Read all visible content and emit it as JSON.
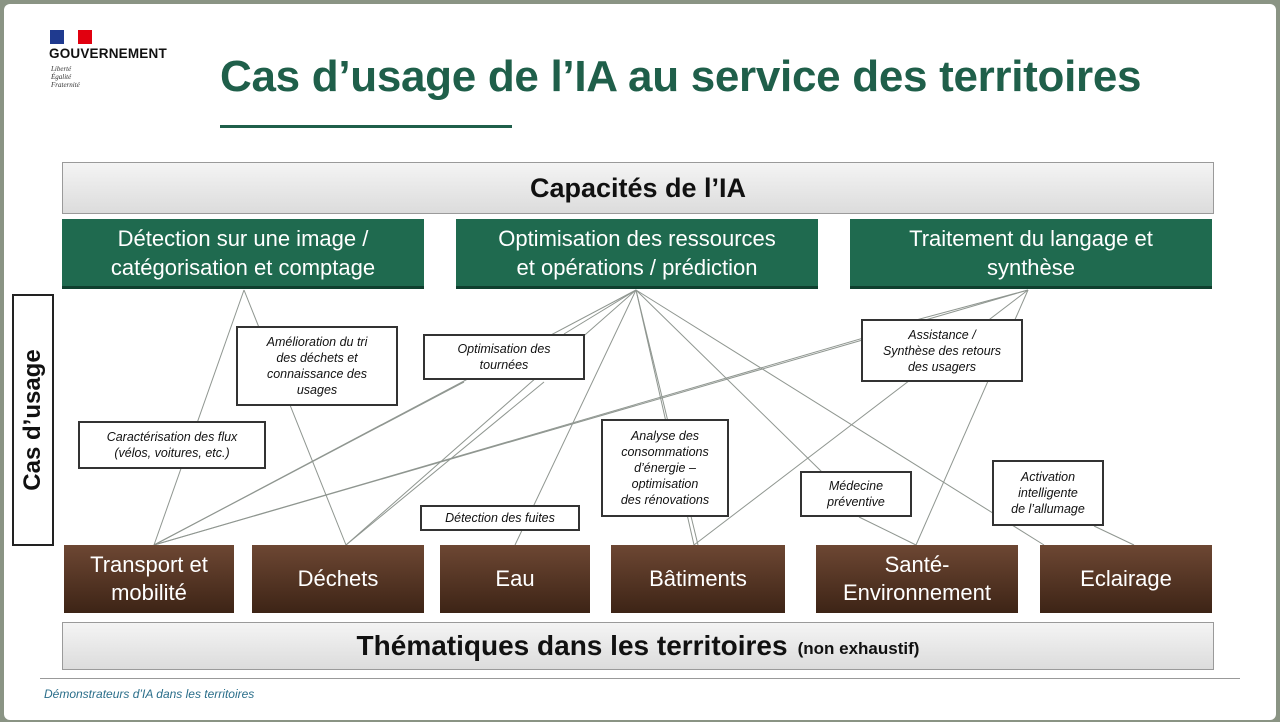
{
  "header": {
    "gov_name": "GOUVERNEMENT",
    "motto_1": "Liberté",
    "motto_2": "Égalité",
    "motto_3": "Fraternité",
    "title": "Cas d’usage de l’IA au service des territoires",
    "flag_colors": [
      "#1f3a8f",
      "#ffffff",
      "#e1000f"
    ]
  },
  "top_bar": {
    "label": "Capacités de l’IA"
  },
  "side_label": "Cas d’usage",
  "capabilities": [
    {
      "label": "Détection sur une image /\ncatégorisation et comptage"
    },
    {
      "label": "Optimisation des ressources\net opérations / prédiction"
    },
    {
      "label": "Traitement du langage et\nsynthèse"
    }
  ],
  "use_cases": [
    {
      "label": "Amélioration du tri\ndes déchets et\nconnaissance des\nusages"
    },
    {
      "label": "Optimisation des\ntournées"
    },
    {
      "label": "Assistance /\nSynthèse des retours\ndes usagers"
    },
    {
      "label": "Caractérisation des flux\n(vélos, voitures, etc.)"
    },
    {
      "label": "Analyse des\nconsommations\nd’énergie –\noptimisation\ndes rénovations"
    },
    {
      "label": "Activation\nintelligente\nde l’allumage"
    },
    {
      "label": "Médecine\npréventive"
    },
    {
      "label": "Détection des fuites"
    }
  ],
  "themes": [
    {
      "label": "Transport et\nmobilité"
    },
    {
      "label": "Déchets"
    },
    {
      "label": "Eau"
    },
    {
      "label": "Bâtiments"
    },
    {
      "label": "Santé-\nEnvironnement"
    },
    {
      "label": "Eclairage"
    }
  ],
  "bottom_bar": {
    "label": "Thématiques dans les territoires",
    "note": "(non exhaustif)"
  },
  "footer": {
    "text": "Démonstrateurs d’IA dans les territoires"
  },
  "colors": {
    "title_green": "#1f5f4a",
    "capability_green": "#1f6a4f",
    "theme_brown": "#5a3826",
    "footer_blue": "#2a6e8a"
  }
}
